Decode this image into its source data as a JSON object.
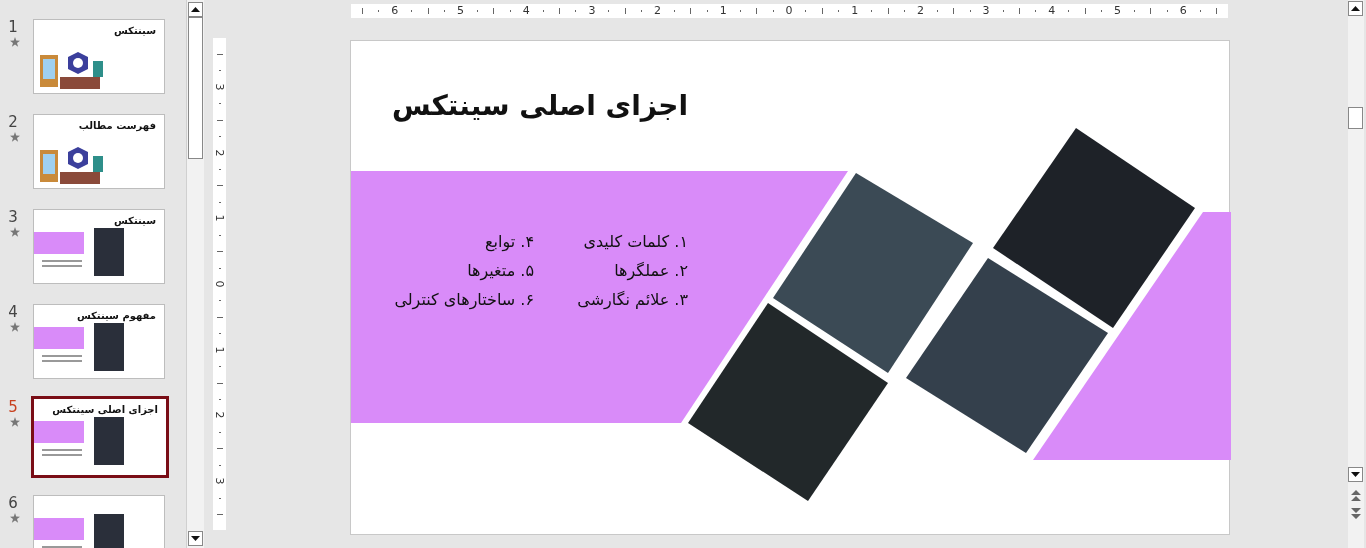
{
  "slides_panel": {
    "thumbnails": [
      {
        "number": "1",
        "title": "سینتکس",
        "kind": "illustration",
        "selected": false
      },
      {
        "number": "2",
        "title": "فهرست مطالب",
        "kind": "illustration",
        "selected": false
      },
      {
        "number": "3",
        "title": "سینتکس",
        "kind": "purple",
        "selected": false
      },
      {
        "number": "4",
        "title": "مفهوم سینتکس",
        "kind": "purple",
        "selected": false
      },
      {
        "number": "5",
        "title": "اجزای اصلی سینتکس",
        "kind": "purple",
        "selected": true
      },
      {
        "number": "6",
        "kind": "purple",
        "selected": false
      }
    ]
  },
  "horizontal_ruler": {
    "labels": [
      "6",
      "5",
      "4",
      "3",
      "2",
      "1",
      "0",
      "1",
      "2",
      "3",
      "4",
      "5",
      "6"
    ]
  },
  "vertical_ruler": {
    "labels": [
      "3",
      "2",
      "1",
      "0",
      "1",
      "2",
      "3"
    ]
  },
  "slide": {
    "title": "اجزای اصلی سینتکس",
    "list_columns": [
      [
        "۱. کلمات کلیدی",
        "۲. عملگرها",
        "۳. علائم نگارشی"
      ],
      [
        "۴. توابع",
        "۵. متغیرها",
        "۶. ساختارهای کنترلی"
      ]
    ]
  }
}
